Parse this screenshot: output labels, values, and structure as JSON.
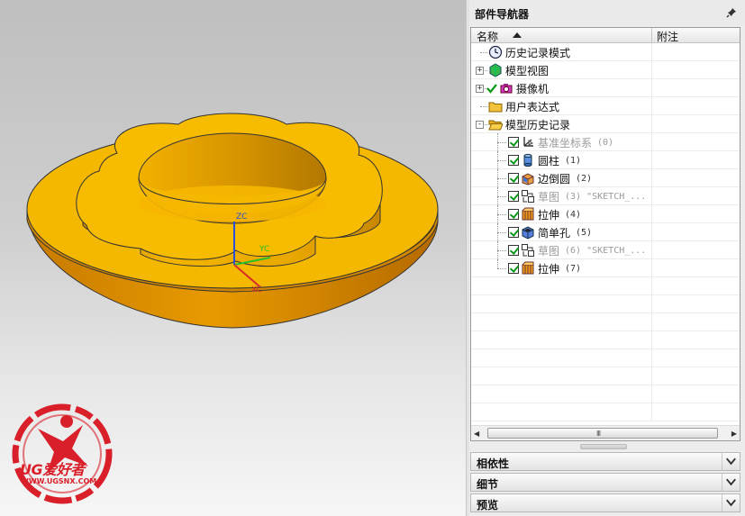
{
  "viewport": {
    "axis_labels": {
      "z": "ZC",
      "y": "YC",
      "x": "XC"
    },
    "model_color": "#F5B800",
    "logo": {
      "text": "UG爱好者",
      "url": "WWW.UGSNX.COM",
      "color": "#D9202A"
    }
  },
  "navigator": {
    "title": "部件导航器",
    "pin_icon": "pin-icon",
    "columns": {
      "name": "名称",
      "note": "附注"
    },
    "rows": [
      {
        "label": "历史记录模式",
        "suffix": "",
        "icon": "clock-icon",
        "level": 0,
        "expander": "",
        "checked": false,
        "gray": false
      },
      {
        "label": "模型视图",
        "suffix": "",
        "icon": "model-views-icon",
        "level": 0,
        "expander": "+",
        "checked": false,
        "gray": false
      },
      {
        "label": "摄像机",
        "suffix": "",
        "icon": "camera-icon",
        "level": 0,
        "expander": "+",
        "checked": true,
        "gray": false
      },
      {
        "label": "用户表达式",
        "suffix": "",
        "icon": "folder-icon",
        "level": 0,
        "expander": "",
        "checked": false,
        "gray": false
      },
      {
        "label": "模型历史记录",
        "suffix": "",
        "icon": "folder-open-icon",
        "level": 0,
        "expander": "-",
        "checked": false,
        "gray": false
      },
      {
        "label": "基准坐标系",
        "suffix": "(0)",
        "icon": "datum-csys-icon",
        "level": 1,
        "expander": "",
        "checked": true,
        "gray": true
      },
      {
        "label": "圆柱",
        "suffix": "(1)",
        "icon": "cylinder-icon",
        "level": 1,
        "expander": "",
        "checked": true,
        "gray": false
      },
      {
        "label": "边倒圆",
        "suffix": "(2)",
        "icon": "edge-blend-icon",
        "level": 1,
        "expander": "",
        "checked": true,
        "gray": false
      },
      {
        "label": "草图",
        "suffix": "(3) \"SKETCH_...",
        "icon": "sketch-icon",
        "level": 1,
        "expander": "",
        "checked": true,
        "gray": true
      },
      {
        "label": "拉伸",
        "suffix": "(4)",
        "icon": "extrude-icon",
        "level": 1,
        "expander": "",
        "checked": true,
        "gray": false
      },
      {
        "label": "简单孔",
        "suffix": "(5)",
        "icon": "hole-icon",
        "level": 1,
        "expander": "",
        "checked": true,
        "gray": false
      },
      {
        "label": "草图",
        "suffix": "(6) \"SKETCH_...",
        "icon": "sketch-icon",
        "level": 1,
        "expander": "",
        "checked": true,
        "gray": true
      },
      {
        "label": "拉伸",
        "suffix": "(7)",
        "icon": "extrude-icon",
        "level": 1,
        "expander": "",
        "checked": true,
        "gray": false
      }
    ],
    "scrollbar": {
      "left_arrow": "◀",
      "right_arrow": "▶",
      "grip": "III"
    },
    "sections": [
      {
        "title": "相依性",
        "icon": "chevron-down-icon"
      },
      {
        "title": "细节",
        "icon": "chevron-down-icon"
      },
      {
        "title": "预览",
        "icon": "chevron-down-icon"
      }
    ]
  }
}
